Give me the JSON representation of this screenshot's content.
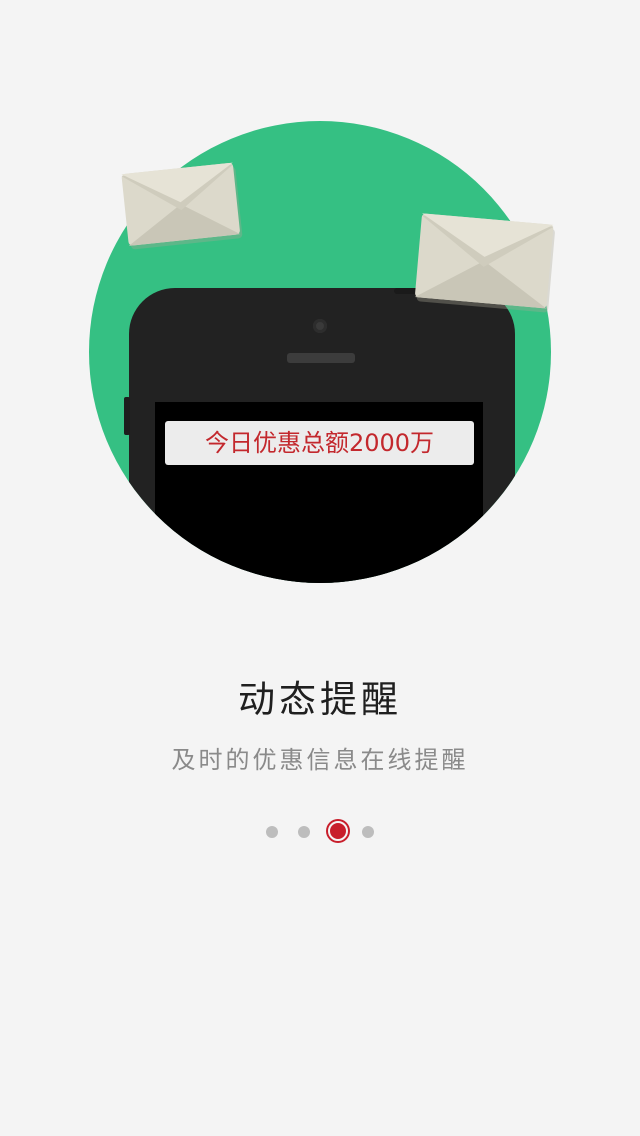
{
  "illustration": {
    "notice_text": "今日优惠总额2000万"
  },
  "content": {
    "title": "动态提醒",
    "subtitle": "及时的优惠信息在线提醒"
  },
  "pager": {
    "total": 4,
    "current_index": 2
  },
  "colors": {
    "background": "#f4f4f4",
    "circle": "#35c083",
    "phone_body": "#222222",
    "notice_text": "#c3282d",
    "active_dot": "#c81e2b",
    "inactive_dot": "#bdbdbd",
    "envelope": "#d9d6c8"
  },
  "icons": {
    "envelope_left": "envelope-icon",
    "envelope_right": "envelope-icon",
    "phone": "smartphone-illustration"
  }
}
